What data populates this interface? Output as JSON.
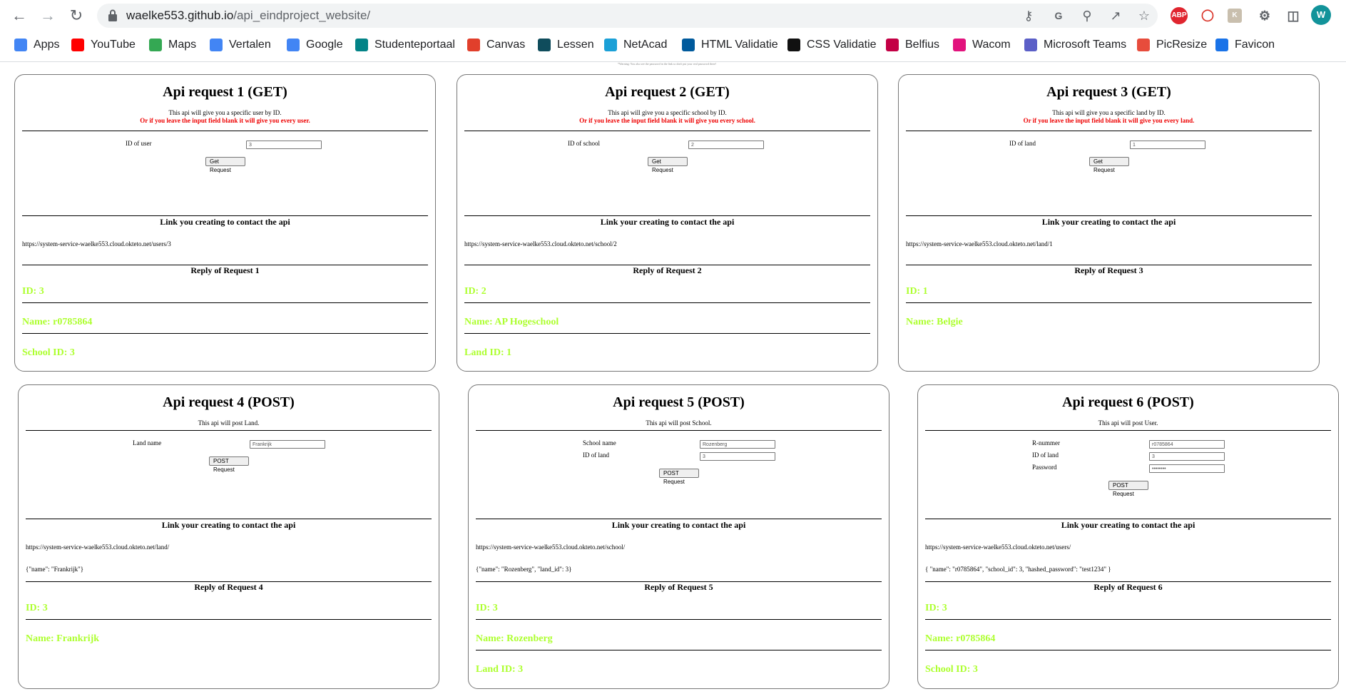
{
  "browser": {
    "url_host": "waelke553.github.io",
    "url_path": "/api_eindproject_website/",
    "profile_initial": "W",
    "extensions": [
      "ABP"
    ]
  },
  "bookmarks": [
    {
      "label": "Apps",
      "icon": "apps-grid-icon",
      "color": "#4285f4"
    },
    {
      "label": "YouTube",
      "icon": "youtube-icon",
      "color": "#ff0000"
    },
    {
      "label": "Maps",
      "icon": "maps-pin-icon",
      "color": "#34a853"
    },
    {
      "label": "Vertalen",
      "icon": "translate-icon",
      "color": "#4285f4"
    },
    {
      "label": "Google",
      "icon": "google-icon",
      "color": "#4285f4"
    },
    {
      "label": "Studenteportaal",
      "icon": "sharepoint-icon",
      "color": "#038387"
    },
    {
      "label": "Canvas",
      "icon": "canvas-icon",
      "color": "#e13f2b"
    },
    {
      "label": "Lessen",
      "icon": "lessen-icon",
      "color": "#0f4c5c"
    },
    {
      "label": "NetAcad",
      "icon": "cisco-icon",
      "color": "#1ba0d7"
    },
    {
      "label": "HTML Validatie",
      "icon": "w3c-icon",
      "color": "#005a9c"
    },
    {
      "label": "CSS Validatie",
      "icon": "css-validator-icon",
      "color": "#111111"
    },
    {
      "label": "Belfius",
      "icon": "belfius-icon",
      "color": "#c30045"
    },
    {
      "label": "Wacom",
      "icon": "wacom-icon",
      "color": "#e2137d"
    },
    {
      "label": "Microsoft Teams",
      "icon": "teams-icon",
      "color": "#5b5fc7"
    },
    {
      "label": "PicResize",
      "icon": "picresize-icon",
      "color": "#e74c3c"
    },
    {
      "label": "Favicon",
      "icon": "favicon-icon",
      "color": "#1a73e8"
    }
  ],
  "page": {
    "tiny_note": "*Warning: You also see the password in the link so don't put your real password there!",
    "link_heading": "Link your creating to contact the api",
    "link_heading_1": "Link you creating to contact the api"
  },
  "cards": [
    {
      "title": "Api request 1 (GET)",
      "desc": "This api will give you a specific user by ID.",
      "warn": "Or if you leave the input field blank it will give you every user.",
      "fields": [
        {
          "label": "ID of user",
          "value": "3"
        }
      ],
      "button": "Get Request",
      "link": "https://system-service-waelke553.cloud.okteto.net/users/3",
      "body": "",
      "reply_heading": "Reply of Request 1",
      "reply": [
        "ID: 3",
        "Name: r0785864",
        "School ID: 3"
      ]
    },
    {
      "title": "Api request 2 (GET)",
      "desc": "This api will give you a specific school by ID.",
      "warn": "Or if you leave the input field blank it will give you every school.",
      "fields": [
        {
          "label": "ID of school",
          "value": "2"
        }
      ],
      "button": "Get Request",
      "link": "https://system-service-waelke553.cloud.okteto.net/school/2",
      "body": "",
      "reply_heading": "Reply of Request 2",
      "reply": [
        "ID: 2",
        "Name: AP Hogeschool",
        "Land ID: 1"
      ]
    },
    {
      "title": "Api request 3 (GET)",
      "desc": "This api will give you a specific land by ID.",
      "warn": "Or if you leave the input field blank it will give you every land.",
      "fields": [
        {
          "label": "ID of land",
          "value": "1"
        }
      ],
      "button": "Get Request",
      "link": "https://system-service-waelke553.cloud.okteto.net/land/1",
      "body": "",
      "reply_heading": "Reply of Request 3",
      "reply": [
        "ID: 1",
        "Name: Belgie"
      ]
    },
    {
      "title": "Api request 4 (POST)",
      "desc": "This api will post Land.",
      "warn": "",
      "fields": [
        {
          "label": "Land name",
          "value": "Frankrijk"
        }
      ],
      "button": "POST Request",
      "link": "https://system-service-waelke553.cloud.okteto.net/land/",
      "body": "{\"name\": \"Frankrijk\"}",
      "reply_heading": "Reply of Request 4",
      "reply": [
        "ID: 3",
        "Name: Frankrijk"
      ]
    },
    {
      "title": "Api request 5 (POST)",
      "desc": "This api will post School.",
      "warn": "",
      "fields": [
        {
          "label": "School name",
          "value": "Rozenberg"
        },
        {
          "label": "ID of land",
          "value": "3"
        }
      ],
      "button": "POST Request",
      "link": "https://system-service-waelke553.cloud.okteto.net/school/",
      "body": "{\"name\": \"Rozenberg\", \"land_id\": 3}",
      "reply_heading": "Reply of Request 5",
      "reply": [
        "ID: 3",
        "Name: Rozenberg",
        "Land ID: 3"
      ]
    },
    {
      "title": "Api request 6 (POST)",
      "desc": "This api will post User.",
      "warn": "",
      "fields": [
        {
          "label": "R-nummer",
          "value": "r0785864"
        },
        {
          "label": "ID of land",
          "value": "3"
        },
        {
          "label": "Password",
          "value": "••••••••"
        }
      ],
      "button": "POST Request",
      "link": "https://system-service-waelke553.cloud.okteto.net/users/",
      "body": "{ \"name\": \"r0785864\", \"school_id\": 3, \"hashed_password\": \"test1234\" }",
      "reply_heading": "Reply of Request 6",
      "reply": [
        "ID: 3",
        "Name: r0785864",
        "School ID: 3"
      ]
    }
  ]
}
